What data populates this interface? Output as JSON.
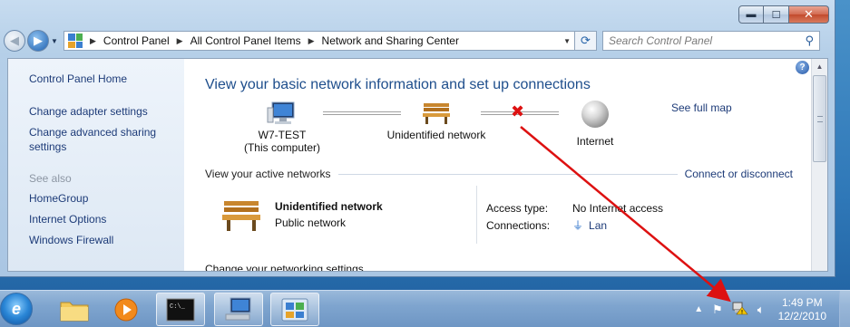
{
  "window": {
    "caption_buttons": {
      "minimize": "▬",
      "maximize": "☐",
      "close": "✕"
    }
  },
  "nav": {
    "breadcrumb": [
      "Control Panel",
      "All Control Panel Items",
      "Network and Sharing Center"
    ],
    "search_placeholder": "Search Control Panel"
  },
  "sidebar": {
    "items": [
      {
        "label": "Control Panel Home"
      },
      {
        "label": "Change adapter settings"
      },
      {
        "label": "Change advanced sharing settings"
      }
    ],
    "see_also_label": "See also",
    "see_also": [
      {
        "label": "HomeGroup"
      },
      {
        "label": "Internet Options"
      },
      {
        "label": "Windows Firewall"
      }
    ]
  },
  "main": {
    "title": "View your basic network information and set up connections",
    "see_full_map": "See full map",
    "map": {
      "computer_name": "W7-TEST",
      "computer_sub": "(This computer)",
      "network": "Unidentified network",
      "internet": "Internet"
    },
    "active_networks_label": "View your active networks",
    "connect_link": "Connect or disconnect",
    "active": {
      "name": "Unidentified network",
      "type": "Public network",
      "access_label": "Access type:",
      "access_value": "No Internet access",
      "connections_label": "Connections:",
      "connections_value": "Lan"
    },
    "change_settings": "Change your networking settings"
  },
  "taskbar": {
    "clock_time": "1:49 PM",
    "clock_date": "12/2/2010"
  },
  "colors": {
    "link": "#1d3b78",
    "title": "#1e4e8c",
    "error_x": "#dd1111",
    "annotation_arrow": "#dd1111"
  }
}
